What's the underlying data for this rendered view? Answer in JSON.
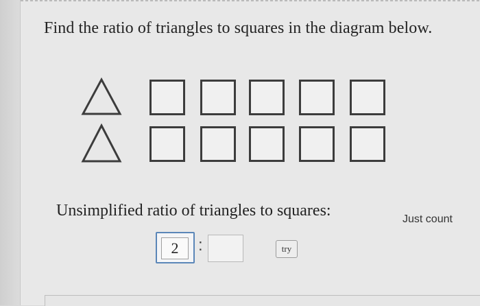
{
  "question": "Find the ratio of triangles to squares in the diagram below.",
  "diagram": {
    "rows": [
      {
        "triangles": 1,
        "squares": 5
      },
      {
        "triangles": 1,
        "squares": 5
      }
    ],
    "shape_color": "#3c3c3c"
  },
  "prompt": "Unsimplified ratio of triangles to squares:",
  "hint": "Just count",
  "answer": {
    "numerator_value": "2",
    "separator": ":",
    "denominator_value": "",
    "try_label": "try"
  },
  "colors": {
    "panel": "#e8e8e8",
    "active_border": "#5a86b8"
  }
}
